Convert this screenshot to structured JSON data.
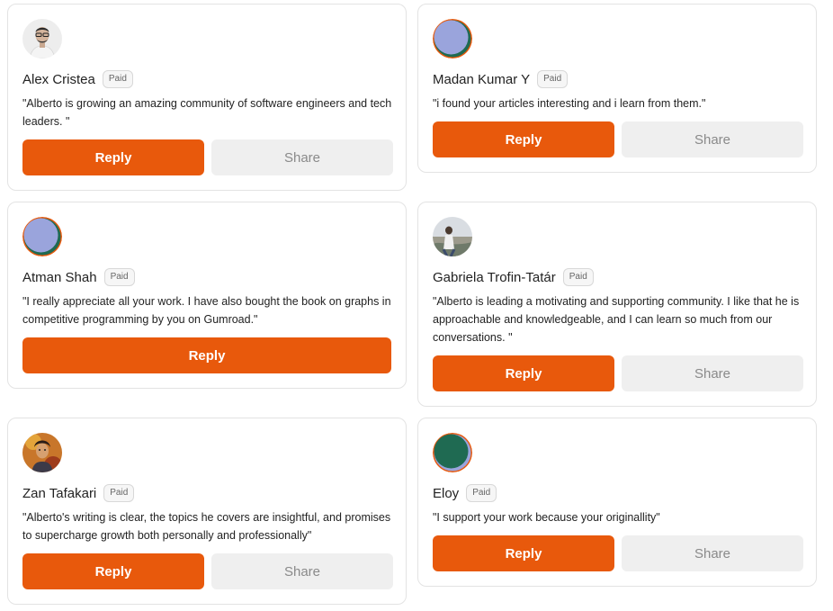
{
  "reply_label": "Reply",
  "share_label": "Share",
  "accent_color": "#e8590c",
  "cards": [
    {
      "name": "Alex Cristea",
      "badge": "Paid",
      "message": "\"Alberto is growing an amazing community of software engineers and tech leaders. \"",
      "avatar": "photo-portrait"
    },
    {
      "name": "Madan Kumar Y",
      "badge": "Paid",
      "message": "\"i found your articles interesting and i learn from them.\"",
      "avatar": "default-purple"
    },
    {
      "name": "Atman Shah",
      "badge": "Paid",
      "message": "\"I really appreciate all your work. I have also bought the book on graphs in competitive programming by you on Gumroad.\"",
      "avatar": "default-purple"
    },
    {
      "name": "Gabriela Trofin-Tatár",
      "badge": "Paid",
      "message": "\"Alberto is leading a motivating and supporting community. I like that he is approachable and knowledgeable, and I can learn so much from our conversations. \"",
      "avatar": "photo-beach"
    },
    {
      "name": "Zan Tafakari",
      "badge": "Paid",
      "message": "\"Alberto's writing is clear, the topics he covers are insightful, and promises to supercharge growth both personally and professionally\"",
      "avatar": "photo-art"
    },
    {
      "name": "Eloy",
      "badge": "Paid",
      "message": "\"I support your work because your originallity\"",
      "avatar": "default-teal"
    }
  ]
}
